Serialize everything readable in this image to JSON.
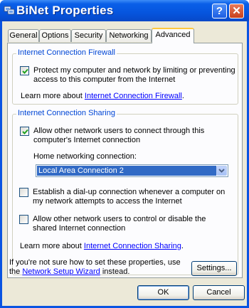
{
  "window": {
    "title": "BiNet Properties"
  },
  "titlebar": {
    "help_label": "?",
    "close_label": "✕"
  },
  "tabs": [
    {
      "label": "General"
    },
    {
      "label": "Options"
    },
    {
      "label": "Security"
    },
    {
      "label": "Networking"
    },
    {
      "label": "Advanced",
      "active": true
    }
  ],
  "firewall": {
    "group_label": "Internet Connection Firewall",
    "protect_checked": true,
    "protect_line1": "Protect my computer and network by limiting or preventing",
    "protect_line2": "access to this computer from the Internet",
    "learn_prefix": "Learn more about",
    "learn_link": "Internet Connection Firewall",
    "learn_suffix": "."
  },
  "sharing": {
    "group_label": "Internet Connection Sharing",
    "allow_connect_checked": true,
    "allow_connect_line1": "Allow other network users to connect through this",
    "allow_connect_line2": "computer's Internet connection",
    "home_label": "Home networking connection:",
    "home_selected": "Local Area Connection 2",
    "dialup_checked": false,
    "dialup_line1": "Establish a dial-up connection whenever a computer on",
    "dialup_line2": "my network attempts to access the Internet",
    "control_checked": false,
    "control_line1": "Allow other network users to control or disable the",
    "control_line2": "shared Internet connection",
    "learn_prefix": "Learn more about",
    "learn_link": "Internet Connection Sharing",
    "learn_suffix": "."
  },
  "footer": {
    "line1": "If you're not sure how to set these properties, use",
    "line2_prefix": "the",
    "wizard_link": "Network Setup Wizard",
    "line2_suffix": "instead.",
    "settings_label": "Settings..."
  },
  "buttons": {
    "ok_label": "OK",
    "cancel_label": "Cancel"
  },
  "colors": {
    "titlebar": "#0655de",
    "dialog_bg": "#ece9d8",
    "group_label": "#0046d5",
    "link": "#0000ff",
    "selection": "#316ac5"
  }
}
